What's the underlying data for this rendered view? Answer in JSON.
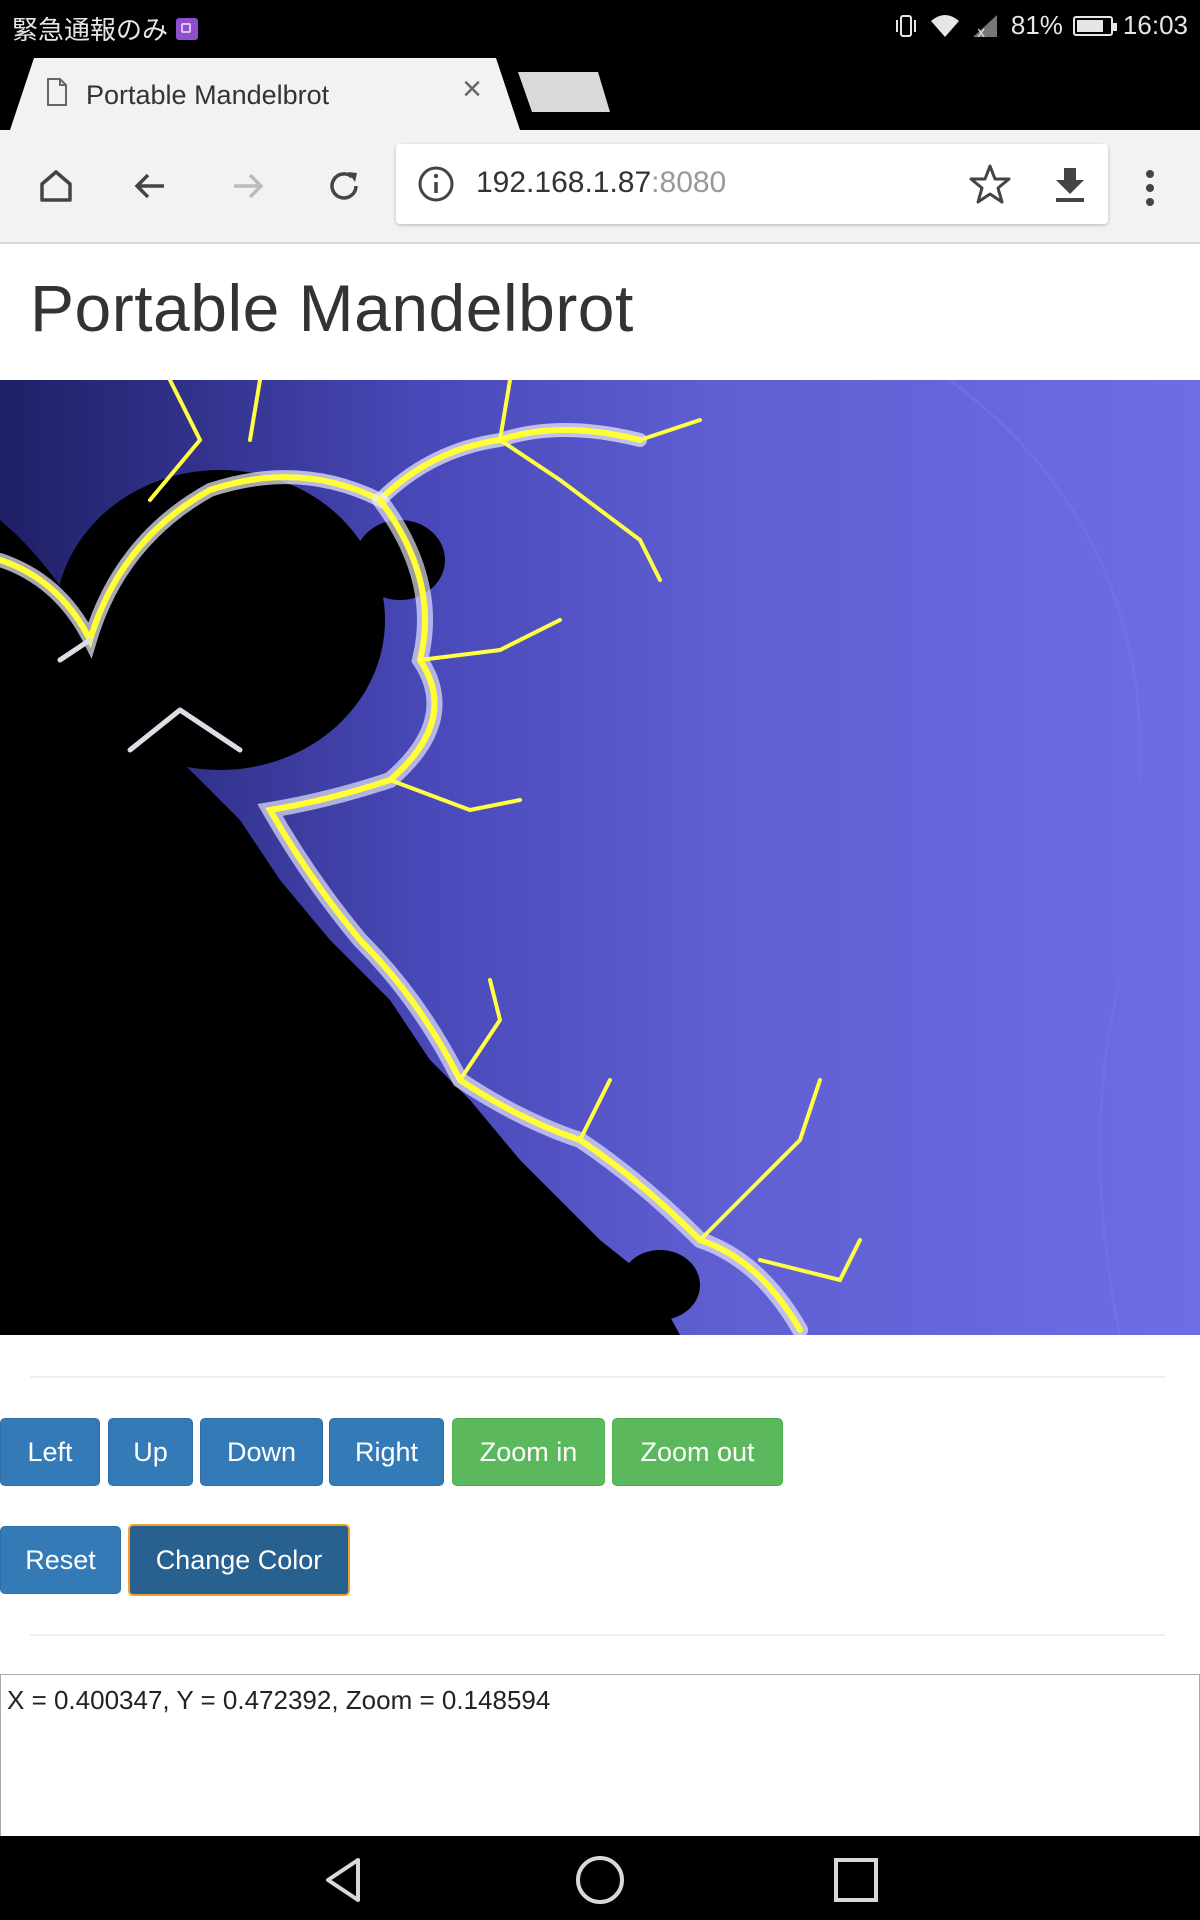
{
  "status_bar": {
    "carrier_text": "緊急通報のみ",
    "battery_percent_label": "81%",
    "battery_level": 0.81,
    "time": "16:03",
    "icons": [
      "notification-icon",
      "vibrate-icon",
      "wifi-icon",
      "signal-icon",
      "battery-icon"
    ]
  },
  "browser": {
    "tab_title": "Portable Mandelbrot",
    "url_host": "192.168.1.87",
    "url_port": ":8080",
    "toolbar_icons": [
      "home-icon",
      "back-icon",
      "forward-icon",
      "reload-icon",
      "info-icon",
      "star-icon",
      "download-icon",
      "menu-icon"
    ]
  },
  "page": {
    "title": "Portable Mandelbrot",
    "nav_buttons": {
      "left": "Left",
      "up": "Up",
      "down": "Down",
      "right": "Right",
      "zoom_in": "Zoom in",
      "zoom_out": "Zoom out"
    },
    "action_buttons": {
      "reset": "Reset",
      "change_color": "Change Color"
    },
    "output_text": "X = 0.400347, Y = 0.472392, Zoom = 0.148594"
  },
  "colors": {
    "primary_button": "#337ab7",
    "success_button": "#5cb85c",
    "fractal_background": "#6a6ae0",
    "fractal_edge": "#ffff33"
  },
  "system_nav": {
    "icons": [
      "nav-back-icon",
      "nav-home-icon",
      "nav-recents-icon"
    ]
  }
}
